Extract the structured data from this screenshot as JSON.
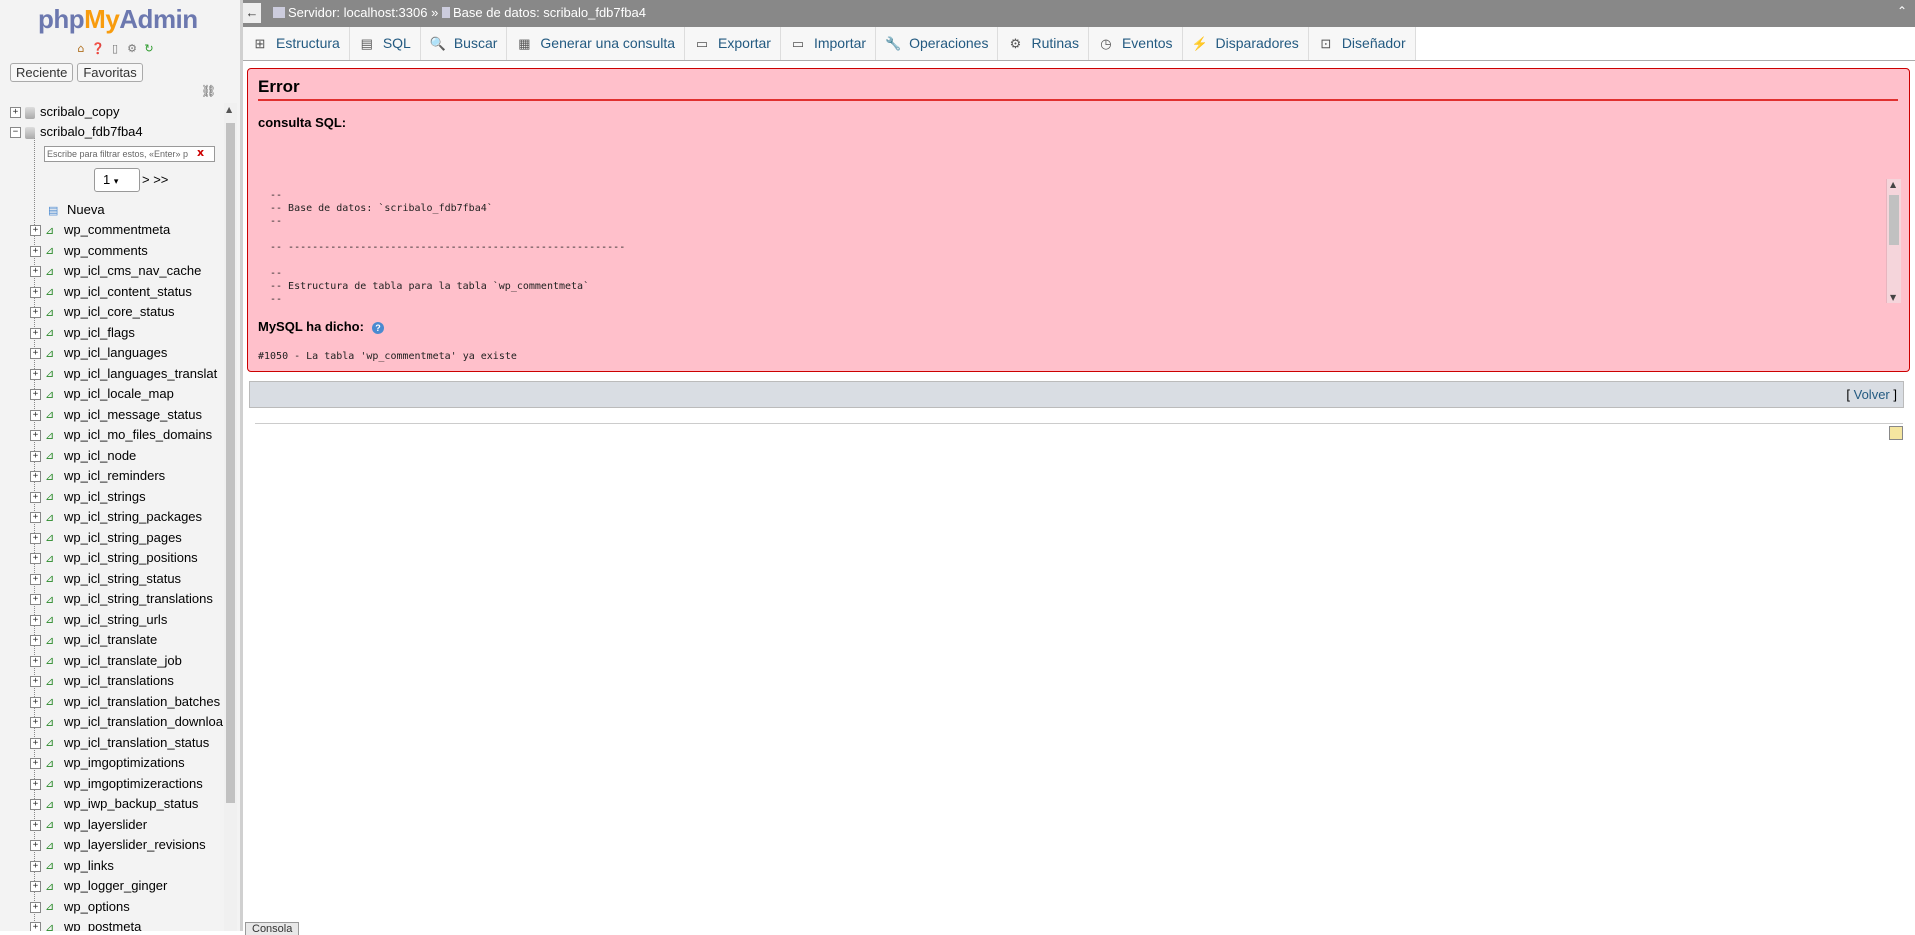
{
  "logo": {
    "php": "php",
    "my": "My",
    "admin": "Admin"
  },
  "nav_tabs": {
    "recent": "Reciente",
    "favorites": "Favoritas"
  },
  "nav_icons": [
    "home-icon",
    "help-icon",
    "docs-icon",
    "settings-icon",
    "reload-icon"
  ],
  "tree": {
    "databases": [
      {
        "name": "scribalo_copy",
        "expanded": false
      },
      {
        "name": "scribalo_fdb7fba4",
        "expanded": true
      }
    ],
    "filter_placeholder": "Escribe para filtrar estos, «Enter» p",
    "filter_clear": "x",
    "page_select": "1",
    "page_next": "> >>",
    "new_label": "Nueva",
    "tables": [
      "wp_commentmeta",
      "wp_comments",
      "wp_icl_cms_nav_cache",
      "wp_icl_content_status",
      "wp_icl_core_status",
      "wp_icl_flags",
      "wp_icl_languages",
      "wp_icl_languages_translat",
      "wp_icl_locale_map",
      "wp_icl_message_status",
      "wp_icl_mo_files_domains",
      "wp_icl_node",
      "wp_icl_reminders",
      "wp_icl_strings",
      "wp_icl_string_packages",
      "wp_icl_string_pages",
      "wp_icl_string_positions",
      "wp_icl_string_status",
      "wp_icl_string_translations",
      "wp_icl_string_urls",
      "wp_icl_translate",
      "wp_icl_translate_job",
      "wp_icl_translations",
      "wp_icl_translation_batches",
      "wp_icl_translation_downloa",
      "wp_icl_translation_status",
      "wp_imgoptimizations",
      "wp_imgoptimizeractions",
      "wp_iwp_backup_status",
      "wp_layerslider",
      "wp_layerslider_revisions",
      "wp_links",
      "wp_logger_ginger",
      "wp_options",
      "wp_postmeta"
    ]
  },
  "breadcrumb": {
    "server": "Servidor: localhost:3306",
    "sep": "»",
    "database": "Base de datos: scribalo_fdb7fba4"
  },
  "tabs": [
    {
      "label": "Estructura",
      "icon": "structure-icon"
    },
    {
      "label": "SQL",
      "icon": "sql-icon"
    },
    {
      "label": "Buscar",
      "icon": "search-icon"
    },
    {
      "label": "Generar una consulta",
      "icon": "query-icon"
    },
    {
      "label": "Exportar",
      "icon": "export-icon"
    },
    {
      "label": "Importar",
      "icon": "import-icon"
    },
    {
      "label": "Operaciones",
      "icon": "wrench-icon"
    },
    {
      "label": "Rutinas",
      "icon": "routines-icon"
    },
    {
      "label": "Eventos",
      "icon": "clock-icon"
    },
    {
      "label": "Disparadores",
      "icon": "triggers-icon"
    },
    {
      "label": "Diseñador",
      "icon": "designer-icon"
    }
  ],
  "error": {
    "title": "Error",
    "sql_label": "consulta SQL:",
    "sql_code": "--\n-- Base de datos: `scribalo_fdb7fba4`\n--\n\n-- --------------------------------------------------------\n\n--\n-- Estructura de tabla para la tabla `wp_commentmeta`\n--",
    "mysql_label": "MySQL ha dicho:",
    "mysql_message": "#1050 - La tabla  'wp_commentmeta' ya existe"
  },
  "back": {
    "open": "[ ",
    "label": "Volver",
    "close": " ]"
  },
  "console": "Consola"
}
